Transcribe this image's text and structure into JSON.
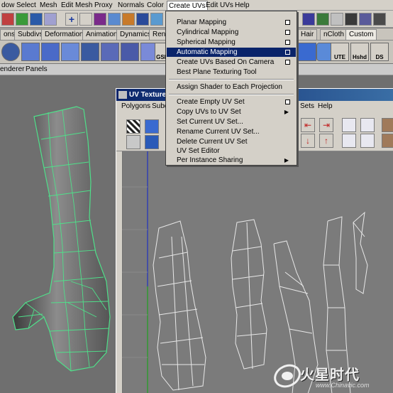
{
  "menubar": {
    "items": [
      "dow",
      "Select",
      "Mesh",
      "Edit Mesh",
      "Proxy",
      "Normals",
      "Color",
      "Create UVs",
      "Edit UVs",
      "Help"
    ],
    "active_item": "Create UVs"
  },
  "shelf_tabs": {
    "left": [
      "ons",
      "Subdivs",
      "Deformation",
      "Animation",
      "Dynamics",
      "Renc"
    ],
    "right": [
      "Hair",
      "nCloth",
      "Custom"
    ],
    "selected": "Custom"
  },
  "shelf_icons": {
    "gs": "GSI",
    "ute": "UTE",
    "hshd": "Hshd",
    "ds": "DS"
  },
  "panel_menu": [
    "enderer",
    "Panels"
  ],
  "uv_editor": {
    "title": "UV Texture",
    "menus_left": [
      "Polygons",
      "Subd"
    ],
    "menus_right": [
      "Sets",
      "Help"
    ]
  },
  "create_uvs_menu": {
    "items": [
      {
        "label": "Planar Mapping",
        "option_box": true
      },
      {
        "label": "Cylindrical Mapping",
        "option_box": true
      },
      {
        "label": "Spherical Mapping",
        "option_box": true
      },
      {
        "label": "Automatic Mapping",
        "option_box": true,
        "highlighted": true
      },
      {
        "label": "Create UVs Based On Camera",
        "option_box": true
      },
      {
        "label": "Best Plane Texturing Tool",
        "option_box": false
      },
      {
        "label": "Assign Shader to Each Projection",
        "option_box": false
      },
      {
        "label": "Create Empty UV Set",
        "option_box": true
      },
      {
        "label": "Copy UVs to UV Set",
        "submenu": true
      },
      {
        "label": "Set Current UV Set...",
        "option_box": false
      },
      {
        "label": "Rename Current UV Set...",
        "option_box": false
      },
      {
        "label": "Delete Current UV Set",
        "option_box": false
      },
      {
        "label": "UV Set Editor",
        "option_box": false
      },
      {
        "label": "Per Instance Sharing",
        "submenu": true
      }
    ]
  },
  "watermark": {
    "logo_text": "火星时代",
    "url": "www.Chinavic.com"
  },
  "colors": {
    "ui_gray": "#d4d0c8",
    "menu_highlight": "#0a246a",
    "viewport": "#6f6f6f",
    "wireframe_green": "#4fe08a",
    "uv_lines": "#e8e8e8"
  }
}
